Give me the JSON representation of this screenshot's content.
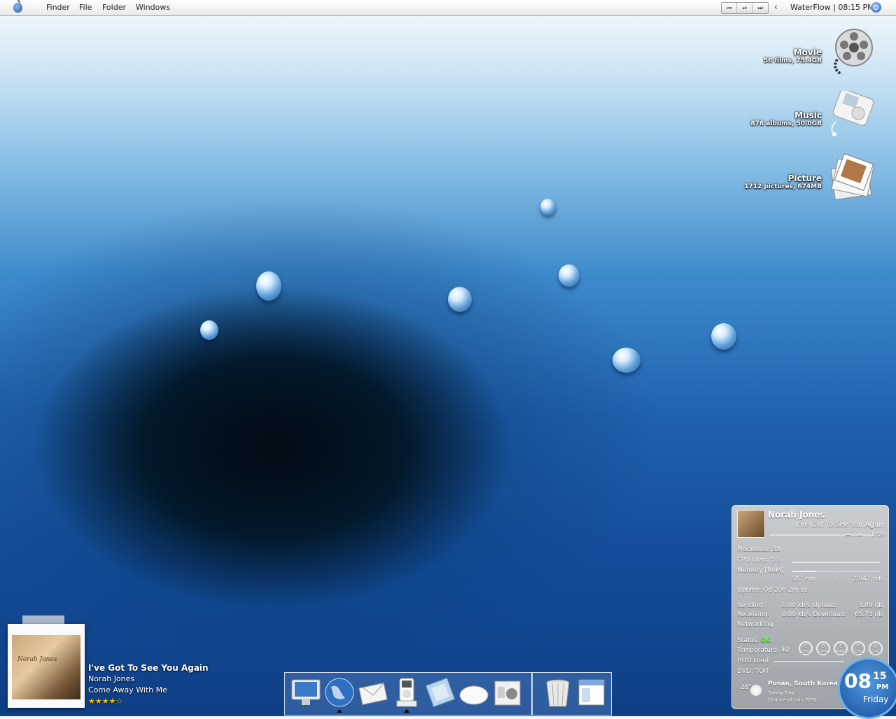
{
  "menubar": {
    "items": [
      "Finder",
      "File",
      "Folder",
      "Windows"
    ],
    "media_controls": [
      "⏮",
      "⏯",
      "⏭"
    ],
    "status": "WaterFlow | 08:15 PM"
  },
  "desktop_icons": [
    {
      "title": "Movie",
      "subtitle": "56 films, 75.4GB",
      "icon": "film-reel-icon"
    },
    {
      "title": "Music",
      "subtitle": "876 albums, 50.0GB",
      "icon": "ipod-icon"
    },
    {
      "title": "Picture",
      "subtitle": "1712 pictures, 674MB",
      "icon": "photo-stack-icon"
    }
  ],
  "panel": {
    "artist": "Norah Jones",
    "track": "I've Got To See You Again",
    "time": "1:59",
    "processes": "Processes: 38",
    "cpu": "CPU Load: 5%",
    "memory": "Memory [RAM]",
    "mem_used": "587 mb",
    "mem_sep": "/",
    "mem_total": "2,047 mb",
    "uptime": "Uptime: 0d 20h 2m 8s",
    "sending_label": "Sending:",
    "sending_val": "0.00 kb/s Upload:",
    "upload": "3.89 gb",
    "receiving_label": "Receiving:",
    "receiving_val": "0.00 kb/s Download:",
    "download": "65.73 gb",
    "networking": "Networking",
    "status_label": "Status:",
    "status_val": "OK",
    "temperature": "Temperature: 40",
    "hdd": "HDD Load",
    "dvd": "DVD: TQIT",
    "drives": [
      {
        "letter": "C",
        "pct": "27%"
      },
      {
        "letter": "D",
        "pct": "78%"
      },
      {
        "letter": "E",
        "pct": "44%"
      },
      {
        "letter": "F",
        "pct": "12%"
      },
      {
        "letter": "G",
        "pct": "1%"
      }
    ],
    "weather_temp": "28°",
    "city": "Pusan, South Korea",
    "condition": "Sunny Day",
    "rain": "Chance of rain 20%",
    "clock_hour": "08",
    "clock_min": "15",
    "clock_ampm": "PM",
    "clock_day": "Friday"
  },
  "now_playing": {
    "title": "I've Got To See You Again",
    "artist": "Norah Jones",
    "album": "Come Away With Me",
    "rating": "★★★★☆",
    "cover_text": "Norah Jones"
  },
  "dock": {
    "apps": [
      "imac-icon",
      "globe-icon",
      "mail-icon",
      "ipod-icon",
      "address-book-icon",
      "mouse-icon",
      "mac-os-icon"
    ],
    "utilities": [
      "trash-icon",
      "window-icon"
    ]
  }
}
